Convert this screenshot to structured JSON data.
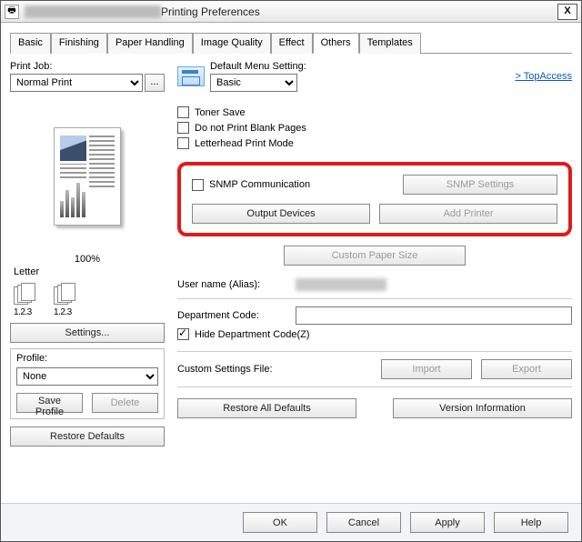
{
  "window": {
    "title": "Printing Preferences",
    "close_glyph": "X"
  },
  "tabs": [
    "Basic",
    "Finishing",
    "Paper Handling",
    "Image Quality",
    "Effect",
    "Others",
    "Templates"
  ],
  "left": {
    "print_job_label": "Print Job:",
    "print_job_value": "Normal Print",
    "more_glyph": "...",
    "zoom": "100%",
    "paper": "Letter",
    "stack_caption": "1.2.3",
    "settings_btn": "Settings...",
    "profile_label": "Profile:",
    "profile_value": "None",
    "save_profile_btn": "Save Profile",
    "delete_btn": "Delete",
    "restore_defaults_btn": "Restore Defaults"
  },
  "right": {
    "default_menu_label": "Default Menu Setting:",
    "default_menu_value": "Basic",
    "topaccess": ">  TopAccess",
    "toner_save": "Toner Save",
    "blank_pages": "Do not Print Blank Pages",
    "letterhead": "Letterhead Print Mode",
    "snmp_comm": "SNMP Communication",
    "snmp_settings_btn": "SNMP Settings",
    "output_devices_btn": "Output Devices",
    "add_printer_btn": "Add Printer",
    "custom_paper_btn": "Custom Paper Size",
    "username_label": "User name (Alias):",
    "dept_code_label": "Department Code:",
    "dept_code_value": "",
    "hide_dept": "Hide Department Code(Z)",
    "custom_settings_label": "Custom Settings File:",
    "import_btn": "Import",
    "export_btn": "Export",
    "restore_all_btn": "Restore All Defaults",
    "version_info_btn": "Version Information"
  },
  "footer": {
    "ok": "OK",
    "cancel": "Cancel",
    "apply": "Apply",
    "help": "Help"
  }
}
